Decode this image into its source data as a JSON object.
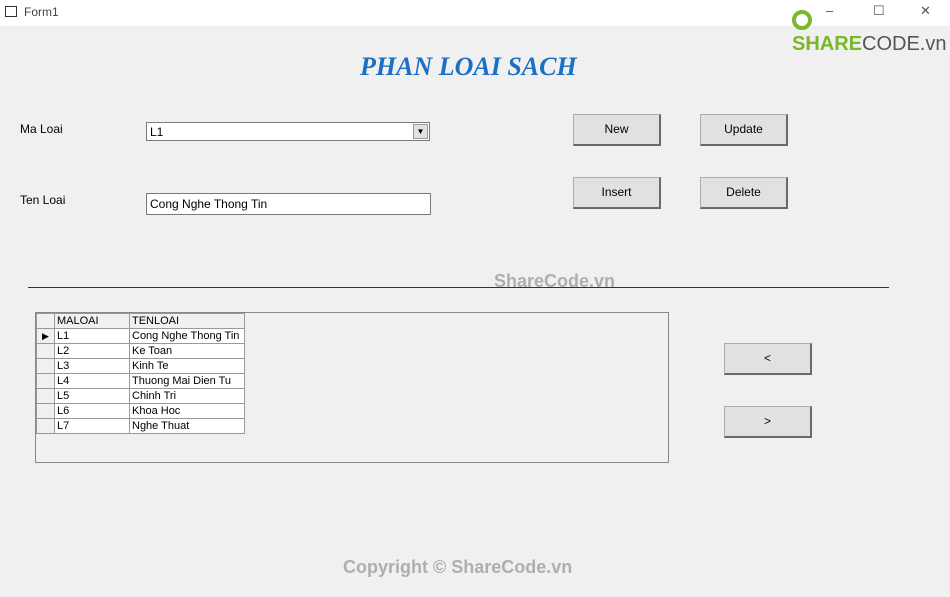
{
  "window": {
    "title": "Form1",
    "minimize": "–",
    "maximize": "☐",
    "close": "✕"
  },
  "logo": {
    "brand": "SHARE",
    "suffix": "CODE.vn"
  },
  "heading": "PHAN LOAI SACH",
  "form": {
    "ma_loai_label": "Ma Loai",
    "ma_loai_value": "L1",
    "ten_loai_label": "Ten Loai",
    "ten_loai_value": "Cong Nghe Thong Tin"
  },
  "buttons": {
    "new": "New",
    "update": "Update",
    "insert": "Insert",
    "delete": "Delete",
    "prev": "<",
    "next": ">"
  },
  "grid": {
    "columns": [
      "MALOAI",
      "TENLOAI"
    ],
    "rows": [
      [
        "L1",
        "Cong Nghe Thong Tin"
      ],
      [
        "L2",
        "Ke Toan"
      ],
      [
        "L3",
        "Kinh Te"
      ],
      [
        "L4",
        "Thuong Mai Dien Tu"
      ],
      [
        "L5",
        "Chinh Tri"
      ],
      [
        "L6",
        "Khoa Hoc"
      ],
      [
        "L7",
        "Nghe Thuat"
      ]
    ],
    "selected_row": 0
  },
  "watermarks": {
    "center": "ShareCode.vn",
    "footer": "Copyright © ShareCode.vn"
  }
}
